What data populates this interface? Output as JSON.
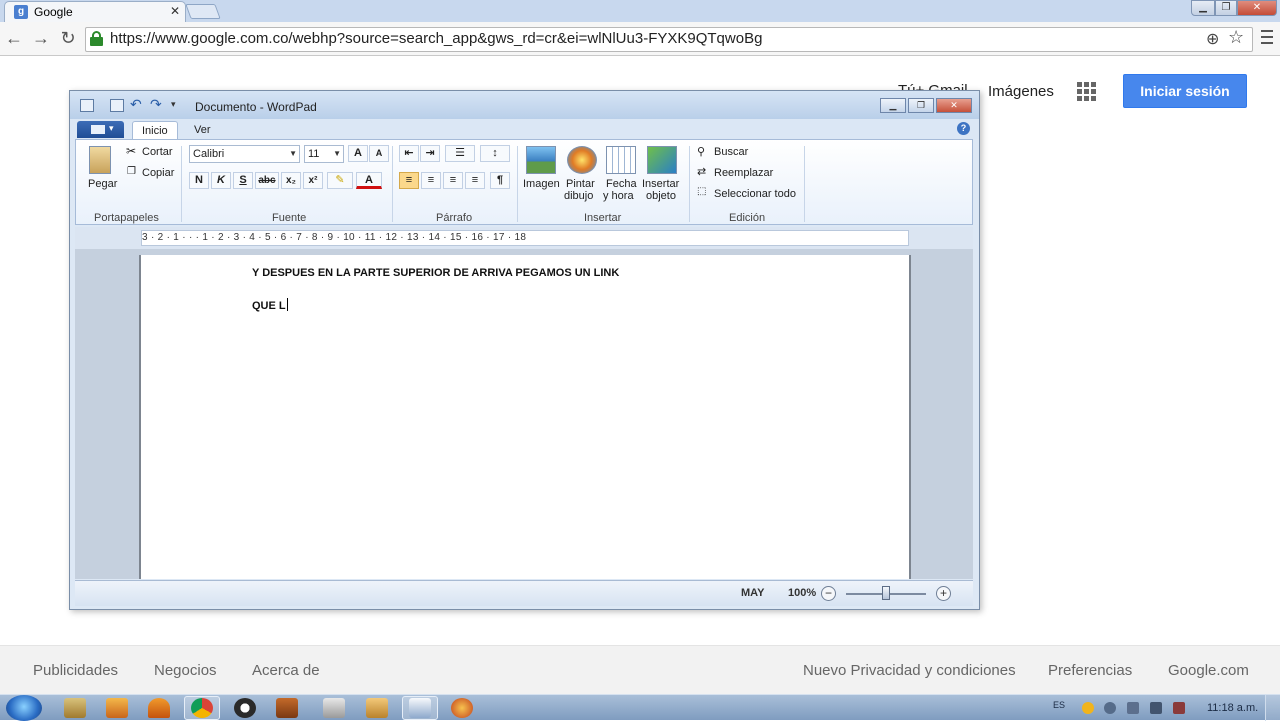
{
  "browser": {
    "tab_title": "Google",
    "tab_close": "✕",
    "url": "https://www.google.com.co/webhp?source=search_app&gws_rd=cr&ei=wlNlUu3-FYXK9QTqwoBg",
    "icons": [
      "back-arrow-icon",
      "forward-arrow-icon",
      "reload-icon",
      "lock-icon",
      "zoom-icon",
      "star-icon",
      "menu-icon"
    ]
  },
  "google": {
    "gmail_partial": "Tú+ Gmail",
    "images": "Imágenes",
    "signin": "Iniciar sesión",
    "footer_left": [
      "Publicidades",
      "Negocios",
      "Acerca de"
    ],
    "footer_right": [
      "Nuevo Privacidad y condiciones",
      "Preferencias",
      "Google.com"
    ]
  },
  "wordpad": {
    "title": "Documento - WordPad",
    "tabs": [
      "Inicio",
      "Ver"
    ],
    "active_tab": "Inicio",
    "help": "?",
    "clipboard": {
      "paste": "Pegar",
      "cut": "Cortar",
      "copy": "Copiar",
      "group": "Portapapeles"
    },
    "font": {
      "family": "Calibri",
      "size": "11",
      "grow": "A",
      "shrink": "A",
      "bold": "N",
      "italic": "K",
      "underline": "S",
      "strike": "abc",
      "subscript": "x₂",
      "superscript": "x²",
      "color": "A",
      "group": "Fuente"
    },
    "paragraph": {
      "group": "Párrafo"
    },
    "insert": {
      "image": "Imagen",
      "paint_1": "Pintar",
      "paint_2": "dibujo",
      "datetime_1": "Fecha",
      "datetime_2": "y hora",
      "object_1": "Insertar",
      "object_2": "objeto",
      "group": "Insertar"
    },
    "edit": {
      "find": "Buscar",
      "replace": "Reemplazar",
      "select_all": "Seleccionar todo",
      "group": "Edición"
    },
    "ruler": "3 · 2 · 1 · · · 1 · 2 · 3 · 4 · 5 · 6 · 7 · 8 · 9 · 10 · 11 · 12 · 13 · 14 · 15 · 16 · 17 · 18",
    "document": {
      "line1": "Y DESPUES EN LA PARTE SUPERIOR DE ARRIVA PEGAMOS UN LINK",
      "line2": "QUE L"
    },
    "status": {
      "caps": "MAY",
      "zoom": "100%",
      "zoom_out": "−",
      "zoom_in": "+",
      "zoom_level": 0.5
    }
  },
  "taskbar": {
    "language": "ES",
    "clock": "11:18 a.m."
  },
  "colors": {
    "signin_blue": "#4787ed",
    "ribbon_bg": "#e9f1fb",
    "taskbar": "#8fa9c9",
    "secure_green": "#2c8a2c"
  }
}
